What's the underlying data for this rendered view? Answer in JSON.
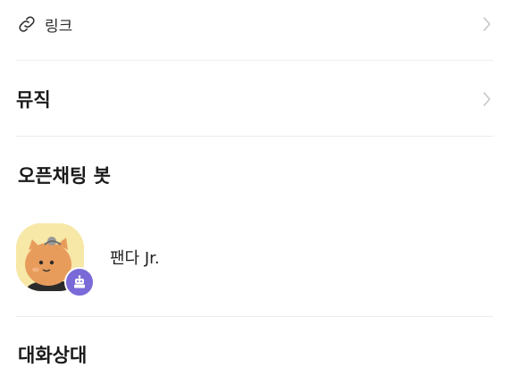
{
  "link_row": {
    "label": "링크"
  },
  "music_row": {
    "label": "뮤직"
  },
  "open_chat_bot": {
    "title": "오픈채팅 봇",
    "bot": {
      "name": "팬다 Jr."
    }
  },
  "chat_partner": {
    "title": "대화상대"
  },
  "colors": {
    "bot_badge": "#7a6ad8",
    "avatar_bg": "#f7e8a8",
    "divider": "#ececec",
    "chevron": "#c4c4c4"
  },
  "icons": {
    "link": "link-icon",
    "chevron": "chevron-right-icon",
    "bot": "robot-icon"
  }
}
